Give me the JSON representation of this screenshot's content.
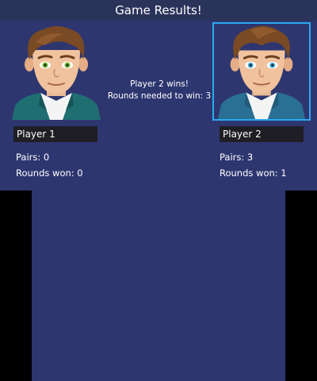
{
  "header": {
    "title": "Game Results!"
  },
  "result": {
    "winner_text": "Player 2 wins!",
    "rounds_needed_text": "Rounds needed to win: 3"
  },
  "players": [
    {
      "name": "Player 1",
      "pairs": "Pairs: 0",
      "rounds_won": "Rounds won: 0",
      "selected": false,
      "eye_color": "#6fb52a",
      "jacket_color": "#1f6f72"
    },
    {
      "name": "Player 2",
      "pairs": "Pairs: 3",
      "rounds_won": "Rounds won: 1",
      "selected": true,
      "eye_color": "#3fa9d6",
      "jacket_color": "#2a6f94"
    }
  ],
  "colors": {
    "background": "#2e3670",
    "title_bar": "#2a3359",
    "name_box": "#1e1e24",
    "selection_border": "#2aa9f0"
  }
}
